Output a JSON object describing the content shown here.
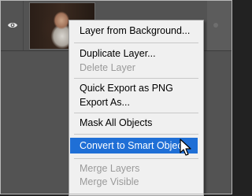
{
  "menu": {
    "items": [
      {
        "label": "Layer from Background...",
        "enabled": true
      },
      {
        "label": "Duplicate Layer...",
        "enabled": true
      },
      {
        "label": "Delete Layer",
        "enabled": false
      },
      {
        "label": "Quick Export as PNG",
        "enabled": true
      },
      {
        "label": "Export As...",
        "enabled": true
      },
      {
        "label": "Mask All Objects",
        "enabled": true
      },
      {
        "label": "Convert to Smart Object",
        "enabled": true,
        "highlighted": true
      },
      {
        "label": "Merge Layers",
        "enabled": false
      },
      {
        "label": "Merge Visible",
        "enabled": false
      }
    ]
  },
  "layer": {
    "visibility_icon": "eye-icon",
    "thumbnail": "portrait of bearded man"
  },
  "colors": {
    "highlight": "#1f6fd6",
    "menu_bg": "#f0f0f0",
    "panel_bg": "#535353"
  }
}
